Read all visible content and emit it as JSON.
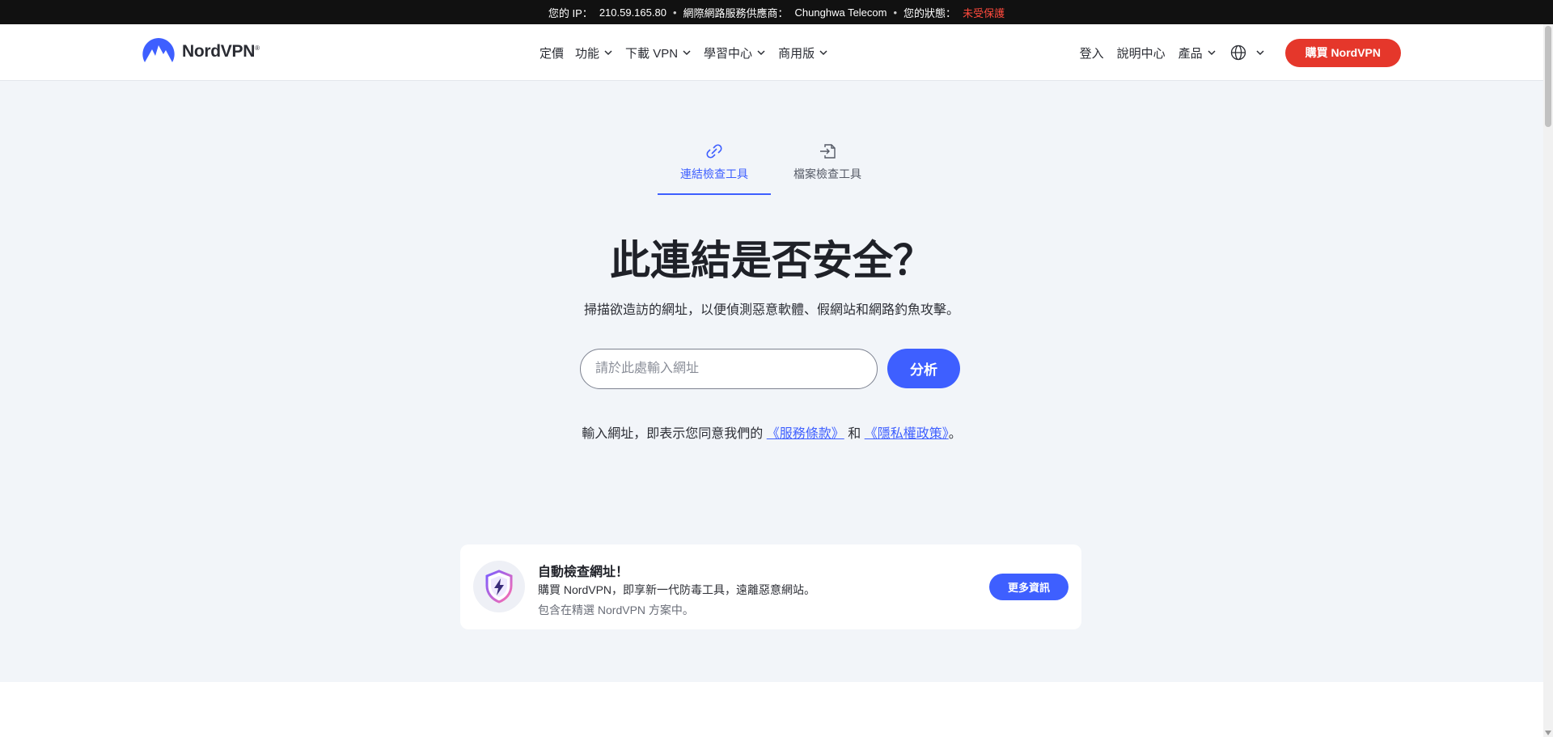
{
  "topbar": {
    "ip_label": "您的 IP：",
    "ip_value": "210.59.165.80",
    "isp_label": "網際網路服務供應商：",
    "isp_value": "Chunghwa Telecom",
    "status_label": "您的狀態：",
    "status_value": "未受保護",
    "separator": "•"
  },
  "header": {
    "logo_text": "NordVPN",
    "logo_mark": "®",
    "nav": [
      "定價",
      "功能",
      "下載 VPN",
      "學習中心",
      "商用版"
    ],
    "right": {
      "login": "登入",
      "help": "說明中心",
      "products": "產品"
    },
    "buy_label": "購買 NordVPN"
  },
  "tabs": [
    {
      "label": "連結檢查工具",
      "icon": "link-icon",
      "active": true
    },
    {
      "label": "檔案檢查工具",
      "icon": "file-import-icon",
      "active": false
    }
  ],
  "main": {
    "title": "此連結是否安全？",
    "subtitle": "掃描欲造訪的網址，以便偵測惡意軟體、假網站和網路釣魚攻擊。",
    "input_placeholder": "請於此處輸入網址",
    "analyze_label": "分析",
    "terms_prefix": "輸入網址，即表示您同意我們的",
    "terms_link": "《服務條款》",
    "terms_and": "和",
    "privacy_link": "《隱私權政策》",
    "terms_suffix": "。"
  },
  "promo": {
    "title": "自動檢查網址！",
    "desc": "購買 NordVPN，即享新一代防毒工具，遠離惡意網站。",
    "note": "包含在精選 NordVPN 方案中。",
    "button": "更多資訊"
  },
  "colors": {
    "accent": "#3e5fff",
    "buy": "#e5372b",
    "warn": "#ff4a3d",
    "bg": "#f2f5f9"
  }
}
